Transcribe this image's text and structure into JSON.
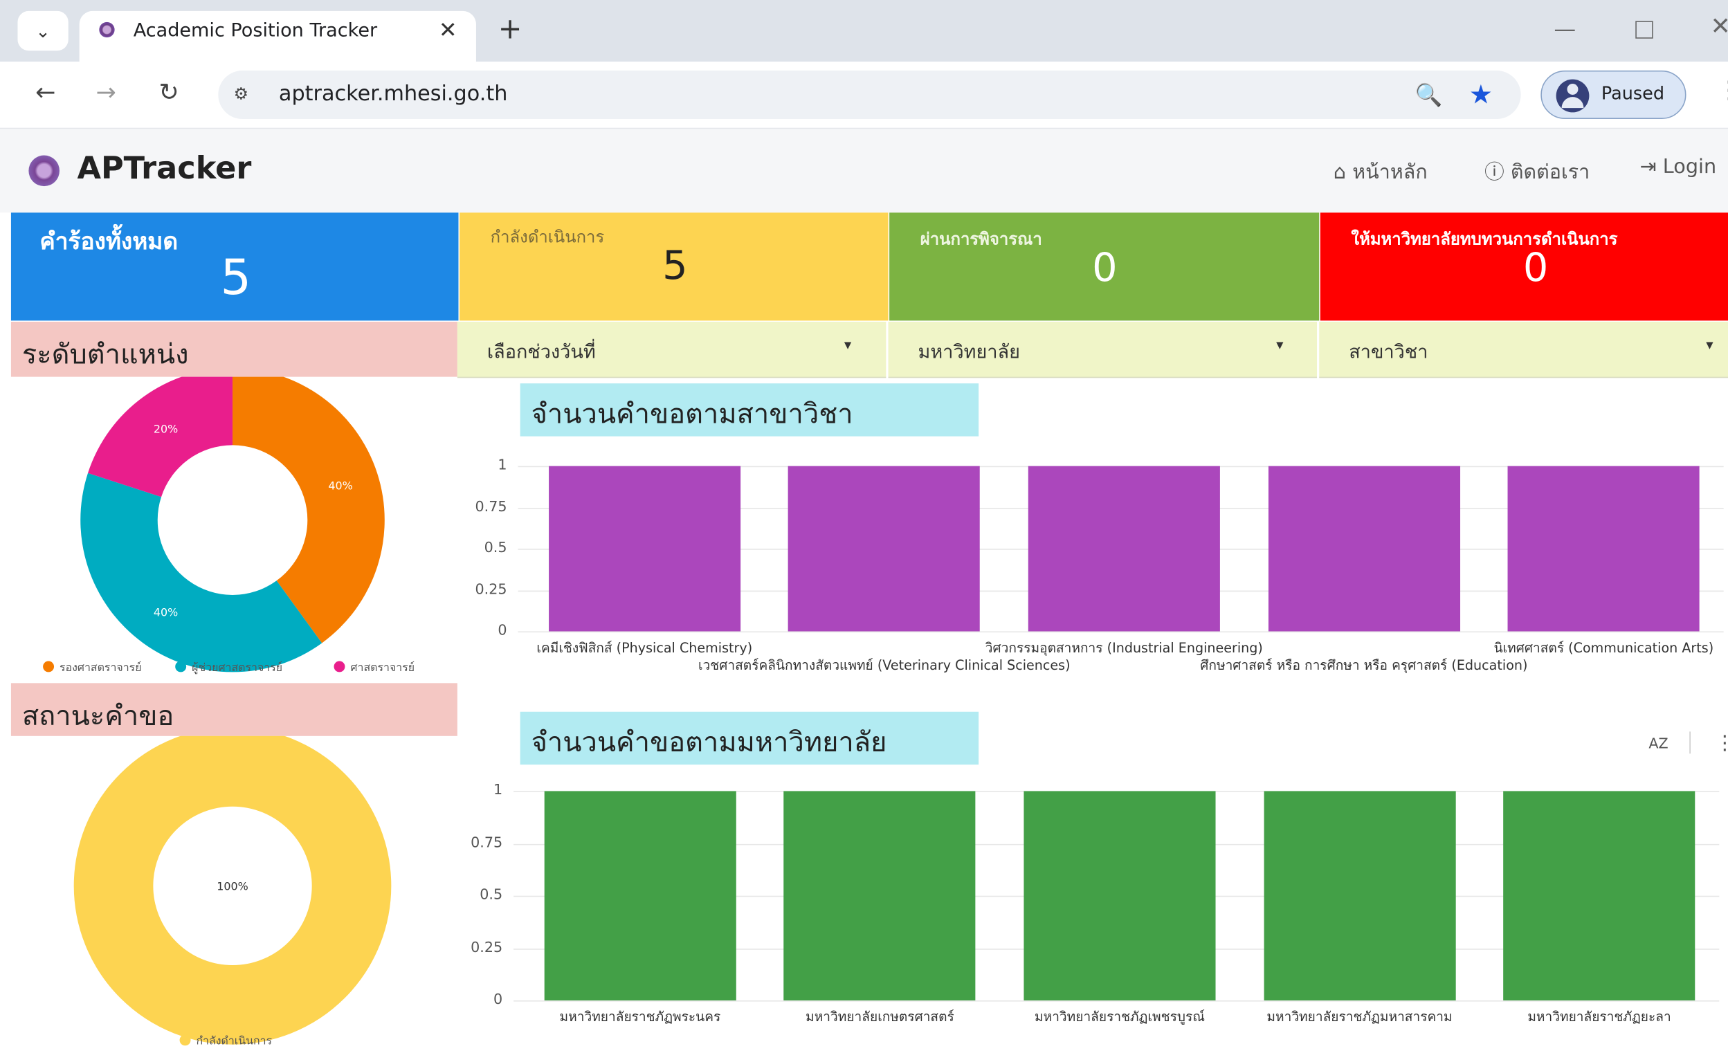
{
  "browser": {
    "tab_title": "Academic Position Tracker",
    "tab_close": "✕",
    "new_tab": "+",
    "url": "aptracker.mhesi.go.th",
    "profile_label": "Paused"
  },
  "header": {
    "brand": "APTracker",
    "nav": [
      {
        "icon": "home-icon",
        "label": "หน้าหลัก"
      },
      {
        "icon": "help-icon",
        "label": "ติดต่อเรา"
      },
      {
        "icon": "login-icon",
        "label": "Login"
      }
    ]
  },
  "kpis": [
    {
      "label": "คำร้องทั้งหมด",
      "value": "5",
      "color": "#1e88e5"
    },
    {
      "label": "กำลังดำเนินการ",
      "value": "5",
      "color": "#fdd451"
    },
    {
      "label": "ผ่านการพิจารณา",
      "value": "0",
      "color": "#7cb342"
    },
    {
      "label": "ให้มหาวิทยาลัยทบทวนการดำเนินการ",
      "value": "0",
      "color": "#ff0000"
    }
  ],
  "filters": [
    "เลือกช่วงวันที่",
    "มหาวิทยาลัย",
    "สาขาวิชา"
  ],
  "sections": {
    "rank": "ระดับตำแหน่ง",
    "status": "สถานะคำขอ",
    "by_field_title": "จำนวนคำขอตามสาขาวิชา",
    "by_univ_title": "จำนวนคำขอตามมหาวิทยาลัย"
  },
  "chart_data": [
    {
      "type": "pie",
      "donut": true,
      "slices": [
        {
          "name": "รองศาสตราจารย์",
          "value": 40,
          "label": "40%",
          "color": "#f57c00"
        },
        {
          "name": "ผู้ช่วยศาสตราจารย์",
          "value": 40,
          "label": "40%",
          "color": "#00acc1"
        },
        {
          "name": "ศาสตราจารย์",
          "value": 20,
          "label": "20%",
          "color": "#e91e8c"
        }
      ],
      "legend": "bottom"
    },
    {
      "type": "pie",
      "donut": true,
      "slices": [
        {
          "name": "กำลังดำเนินการ",
          "value": 100,
          "label": "100%",
          "color": "#fdd451"
        }
      ],
      "legend": "bottom"
    },
    {
      "type": "bar",
      "title": "จำนวนคำขอตามสาขาวิชา",
      "categories": [
        "เคมีเชิงฟิสิกส์ (Physical Chemistry)",
        "เวชศาสตร์คลินิกทางสัตวแพทย์ (Veterinary Clinical Sciences)",
        "วิศวกรรมอุตสาหการ (Industrial Engineering)",
        "ศึกษาศาสตร์ หรือ การศึกษา หรือ ครุศาสตร์ (Education)",
        "นิเทศศาสตร์ (Communication Arts)"
      ],
      "values": [
        1,
        1,
        1,
        1,
        1
      ],
      "yticks": [
        "0",
        "0.25",
        "0.5",
        "0.75",
        "1"
      ],
      "ylim": [
        0,
        1
      ],
      "color": "#ab47bc",
      "grid": true
    },
    {
      "type": "bar",
      "title": "จำนวนคำขอตามมหาวิทยาลัย",
      "categories": [
        "มหาวิทยาลัยราชภัฏพระนคร",
        "มหาวิทยาลัยเกษตรศาสตร์",
        "มหาวิทยาลัยราชภัฏเพชรบูรณ์",
        "มหาวิทยาลัยราชภัฏมหาสารคาม",
        "มหาวิทยาลัยราชภัฏยะลา"
      ],
      "values": [
        1,
        1,
        1,
        1,
        1
      ],
      "yticks": [
        "0",
        "0.25",
        "0.5",
        "0.75",
        "1"
      ],
      "ylim": [
        0,
        1
      ],
      "color": "#43a047",
      "grid": true
    }
  ],
  "chart_tools": {
    "sort_label": "AZ"
  }
}
